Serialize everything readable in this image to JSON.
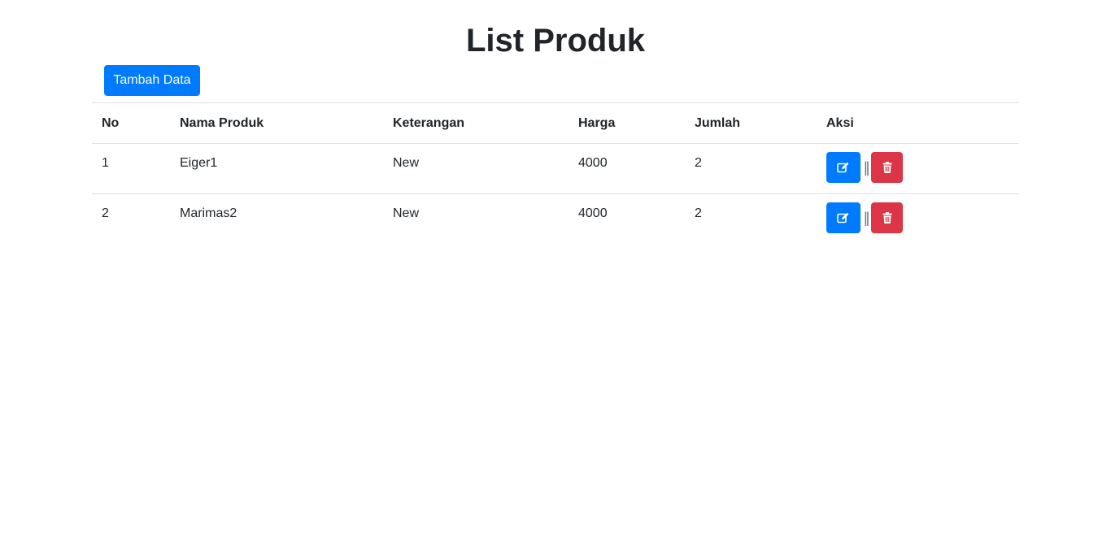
{
  "page": {
    "title": "List Produk",
    "add_button_label": "Tambah Data"
  },
  "table": {
    "headers": [
      "No",
      "Nama Produk",
      "Keterangan",
      "Harga",
      "Jumlah",
      "Aksi"
    ],
    "rows": [
      {
        "no": "1",
        "nama": "Eiger1",
        "keterangan": "New",
        "harga": "4000",
        "jumlah": "2"
      },
      {
        "no": "2",
        "nama": "Marimas2",
        "keterangan": "New",
        "harga": "4000",
        "jumlah": "2"
      }
    ],
    "separator": "||"
  },
  "icons": {
    "edit": "edit-icon",
    "delete": "trash-icon"
  },
  "colors": {
    "primary": "#007bff",
    "danger": "#dc3545",
    "text": "#212529"
  }
}
